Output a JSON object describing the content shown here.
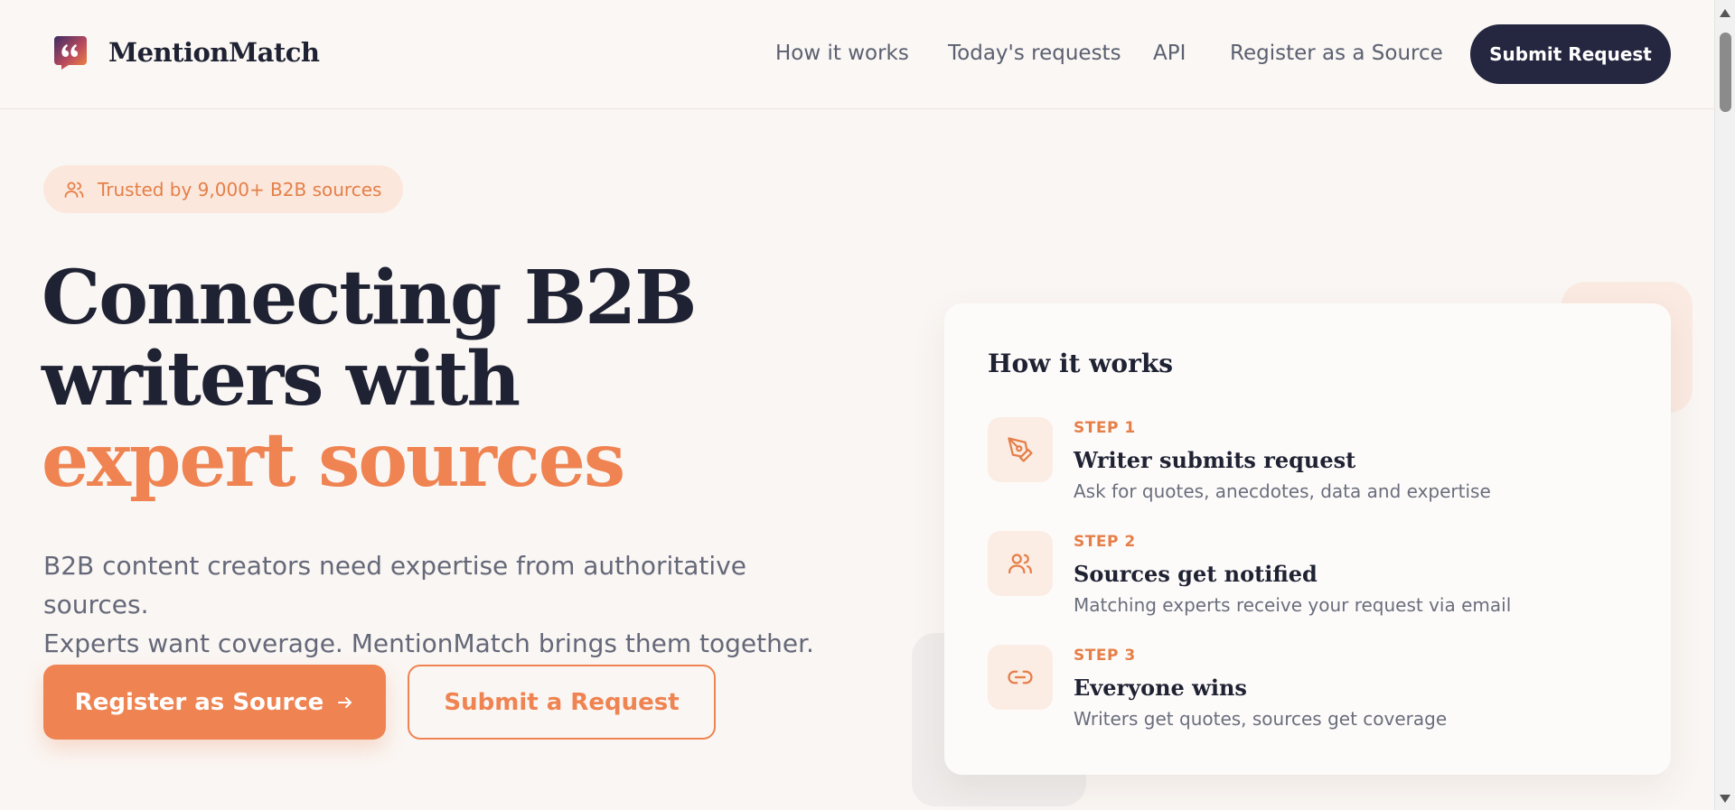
{
  "brand": {
    "name": "MentionMatch",
    "logo_icon": "quote-bubble-icon",
    "accent_color": "#ef8351",
    "dark_color": "#25263f"
  },
  "nav": {
    "items": [
      {
        "label": "How it works"
      },
      {
        "label": "Today's requests"
      },
      {
        "label": "API"
      },
      {
        "label": "Register as a Source"
      }
    ],
    "cta_label": "Submit Request"
  },
  "hero": {
    "badge": "Trusted by 9,000+ B2B sources",
    "badge_icon": "users-icon",
    "title_line1": "Connecting B2B",
    "title_line2": "writers with",
    "title_accent": "expert sources",
    "desc_line1": "B2B content creators need expertise from authoritative sources.",
    "desc_line2": "Experts want coverage. MentionMatch brings them together.",
    "primary_button": "Register as Source",
    "primary_button_icon": "arrow-right-icon",
    "secondary_button": "Submit a Request"
  },
  "how_it_works": {
    "title": "How it works",
    "steps": [
      {
        "label": "STEP 1",
        "title": "Writer submits request",
        "desc": "Ask for quotes, anecdotes, data and expertise",
        "icon": "pen-tool-icon"
      },
      {
        "label": "STEP 2",
        "title": "Sources get notified",
        "desc": "Matching experts receive your request via email",
        "icon": "users-icon"
      },
      {
        "label": "STEP 3",
        "title": "Everyone wins",
        "desc": "Writers get quotes, sources get coverage",
        "icon": "link-icon"
      }
    ]
  }
}
